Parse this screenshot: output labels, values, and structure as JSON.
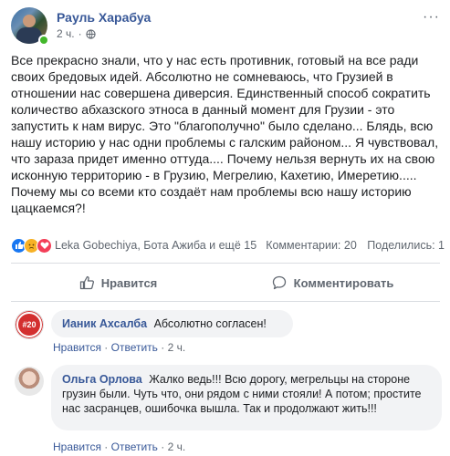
{
  "post": {
    "author": "Рауль Харабуа",
    "time": "2 ч.",
    "separator": "·",
    "more_label": "···",
    "text": "Все прекрасно знали, что у нас есть противник, готовый на все ради своих бредовых идей. Абсолютно не сомневаюсь, что Грузией в отношении нас совершена диверсия. Единственный способ сократить количество абхазского этноса в данный момент для Грузии - это запустить к нам вирус. Это \"благополучно\" было сделано... Блядь, всю нашу историю у нас одни проблемы с галским районом... Я чувствовал, что зараза придет именно оттуда.... Почему нельзя вернуть их на свою исконную территорию - в Грузию, Мегрелию, Кахетию, Имеретию..... Почему мы со всеми кто создаёт нам проблемы всю нашу историю цацкаемся?!"
  },
  "reactions": {
    "names": "Leka Gobechiya, Бота Ажиба и ещё 15",
    "comments": "Комментарии: 20",
    "shares": "Поделились: 1",
    "icons": [
      "like-icon",
      "sad-icon",
      "love-icon"
    ]
  },
  "actions": {
    "like": "Нравится",
    "comment": "Комментировать"
  },
  "comments": [
    {
      "author": "Ианик Ахсалба",
      "text": "Абсолютно согласен!",
      "avatar_text": "#20",
      "like": "Нравится",
      "reply": "Ответить",
      "time": "2 ч."
    },
    {
      "author": "Ольга Орлова",
      "text": "Жалко ведь!!! Всю дорогу, мегрельцы на стороне грузин были. Чуть что, они рядом с ними стояли! А потом; простите нас засранцев, ошибочка вышла. Так и продолжают жить!!!",
      "like": "Нравится",
      "reply": "Ответить",
      "time": "2 ч."
    }
  ],
  "colors": {
    "link": "#385898",
    "secondary_text": "#606770",
    "bubble_bg": "#f2f3f5",
    "like_blue": "#1877f2",
    "online_green": "#42b72a"
  }
}
